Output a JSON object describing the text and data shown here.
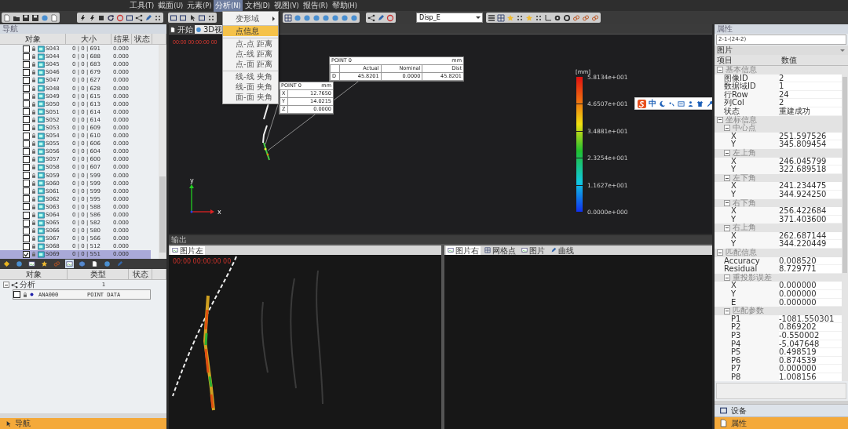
{
  "menu_bar": {
    "items": [
      {
        "label": "工具",
        "shortcut": "(T)",
        "open": false
      },
      {
        "label": "截面",
        "shortcut": "(U)",
        "open": false
      },
      {
        "label": "元素",
        "shortcut": "(P)",
        "open": false
      },
      {
        "label": "分析",
        "shortcut": "(N)",
        "open": true
      },
      {
        "label": "文档",
        "shortcut": "(D)",
        "open": false
      },
      {
        "label": "视图",
        "shortcut": "(V)",
        "open": false
      },
      {
        "label": "报告",
        "shortcut": "(R)",
        "open": false
      },
      {
        "label": "帮助",
        "shortcut": "(H)",
        "open": false
      }
    ]
  },
  "toolbar": {
    "display_combo": "Disp_E"
  },
  "analysis_menu": {
    "items": [
      {
        "label": "变形域",
        "has_submenu": true,
        "divider_above": false,
        "selected": false
      },
      {
        "label": "点信息",
        "has_submenu": false,
        "divider_above": true,
        "selected": true
      },
      {
        "label": "点-点 距离",
        "has_submenu": false,
        "divider_above": true,
        "selected": false
      },
      {
        "label": "点-线 距离",
        "has_submenu": false,
        "divider_above": false,
        "selected": false
      },
      {
        "label": "点-面 距离",
        "has_submenu": false,
        "divider_above": false,
        "selected": false
      },
      {
        "label": "线-线 夹角",
        "has_submenu": false,
        "divider_above": true,
        "selected": false
      },
      {
        "label": "线-面 夹角",
        "has_submenu": false,
        "divider_above": false,
        "selected": false
      },
      {
        "label": "面-面 夹角",
        "has_submenu": false,
        "divider_above": false,
        "selected": false
      }
    ]
  },
  "navigator": {
    "title": "导航",
    "columns": [
      "对象",
      "大小",
      "结果",
      "状态"
    ],
    "rows": [
      {
        "name": "S043",
        "size": "0 | 0 | 691",
        "result": "0.000",
        "checked": false,
        "selected": false
      },
      {
        "name": "S044",
        "size": "0 | 0 | 688",
        "result": "0.000",
        "checked": false,
        "selected": false
      },
      {
        "name": "S045",
        "size": "0 | 0 | 683",
        "result": "0.000",
        "checked": false,
        "selected": false
      },
      {
        "name": "S046",
        "size": "0 | 0 | 679",
        "result": "0.000",
        "checked": false,
        "selected": false
      },
      {
        "name": "S047",
        "size": "0 | 0 | 627",
        "result": "0.000",
        "checked": false,
        "selected": false
      },
      {
        "name": "S048",
        "size": "0 | 0 | 628",
        "result": "0.000",
        "checked": false,
        "selected": false
      },
      {
        "name": "S049",
        "size": "0 | 0 | 615",
        "result": "0.000",
        "checked": false,
        "selected": false
      },
      {
        "name": "S050",
        "size": "0 | 0 | 613",
        "result": "0.000",
        "checked": false,
        "selected": false
      },
      {
        "name": "S051",
        "size": "0 | 0 | 614",
        "result": "0.000",
        "checked": false,
        "selected": false
      },
      {
        "name": "S052",
        "size": "0 | 0 | 614",
        "result": "0.000",
        "checked": false,
        "selected": false
      },
      {
        "name": "S053",
        "size": "0 | 0 | 609",
        "result": "0.000",
        "checked": false,
        "selected": false
      },
      {
        "name": "S054",
        "size": "0 | 0 | 610",
        "result": "0.000",
        "checked": false,
        "selected": false
      },
      {
        "name": "S055",
        "size": "0 | 0 | 606",
        "result": "0.000",
        "checked": false,
        "selected": false
      },
      {
        "name": "S056",
        "size": "0 | 0 | 604",
        "result": "0.000",
        "checked": false,
        "selected": false
      },
      {
        "name": "S057",
        "size": "0 | 0 | 600",
        "result": "0.000",
        "checked": false,
        "selected": false
      },
      {
        "name": "S058",
        "size": "0 | 0 | 607",
        "result": "0.000",
        "checked": false,
        "selected": false
      },
      {
        "name": "S059",
        "size": "0 | 0 | 599",
        "result": "0.000",
        "checked": false,
        "selected": false
      },
      {
        "name": "S060",
        "size": "0 | 0 | 599",
        "result": "0.000",
        "checked": false,
        "selected": false
      },
      {
        "name": "S061",
        "size": "0 | 0 | 599",
        "result": "0.000",
        "checked": false,
        "selected": false
      },
      {
        "name": "S062",
        "size": "0 | 0 | 595",
        "result": "0.000",
        "checked": false,
        "selected": false
      },
      {
        "name": "S063",
        "size": "0 | 0 | 588",
        "result": "0.000",
        "checked": false,
        "selected": false
      },
      {
        "name": "S064",
        "size": "0 | 0 | 586",
        "result": "0.000",
        "checked": false,
        "selected": false
      },
      {
        "name": "S065",
        "size": "0 | 0 | 582",
        "result": "0.000",
        "checked": false,
        "selected": false
      },
      {
        "name": "S066",
        "size": "0 | 0 | 580",
        "result": "0.000",
        "checked": false,
        "selected": false
      },
      {
        "name": "S067",
        "size": "0 | 0 | 566",
        "result": "0.000",
        "checked": false,
        "selected": false
      },
      {
        "name": "S068",
        "size": "0 | 0 | 512",
        "result": "0.000",
        "checked": false,
        "selected": false
      },
      {
        "name": "S069",
        "size": "0 | 0 | 551",
        "result": "0.000",
        "checked": true,
        "selected": true
      }
    ],
    "icon_tabs": [
      {
        "selected": false
      },
      {
        "selected": false
      },
      {
        "selected": false
      },
      {
        "selected": false
      },
      {
        "selected": false
      },
      {
        "selected": true
      },
      {
        "selected": false
      },
      {
        "selected": false
      },
      {
        "selected": false
      },
      {
        "selected": false
      }
    ],
    "lower_columns": [
      "对象",
      "类型",
      "状态"
    ],
    "tree": [
      {
        "name": "分析",
        "type": "1",
        "expanded": true,
        "children": [
          {
            "name": "ANA000",
            "type": "POINT DATA",
            "checked": false
          }
        ]
      }
    ],
    "footer": "导航"
  },
  "view_tabs": [
    {
      "label": "开始",
      "selected": false
    },
    {
      "label": "3D视",
      "selected": true
    }
  ],
  "view_3d": {
    "timestamp": "00:00 00:00:00 00",
    "point_label": {
      "title": "POINT 0",
      "unit": "mm",
      "rows": [
        {
          "axis": "X",
          "value": "12.7650"
        },
        {
          "axis": "Y",
          "value": "14.0215"
        },
        {
          "axis": "Z",
          "value": "0.0000"
        }
      ]
    },
    "deviation_label": {
      "title": "POINT 0",
      "unit": "mm",
      "columns": [
        "Actual",
        "Nominal",
        "Dist"
      ],
      "row": {
        "axis": "D",
        "values": [
          "45.8201",
          "0.0000",
          "45.8201"
        ]
      }
    },
    "color_scale": {
      "unit": "[mm]",
      "ticks": [
        "5.8134e+001",
        "4.6507e+001",
        "3.4881e+001",
        "2.3254e+001",
        "1.1627e+001",
        "0.0000e+000"
      ]
    },
    "axes": {
      "vertical": "y",
      "horizontal": "x"
    }
  },
  "ime_toolbar": {
    "mode": "中"
  },
  "output": {
    "title": "输出",
    "left_tabs": [
      {
        "label": "图片左",
        "selected": true
      }
    ],
    "left_timestamp": "00:00 00:00:00 00",
    "right_tabs": [
      {
        "label": "图片右",
        "selected": true
      },
      {
        "label": "网格点",
        "selected": false
      },
      {
        "label": "图片",
        "selected": false
      },
      {
        "label": "曲线",
        "selected": false
      }
    ]
  },
  "properties": {
    "title": "属性",
    "path": "2-1-(24-2)",
    "category": "图片",
    "columns": [
      "项目",
      "数值"
    ],
    "groups": [
      {
        "label": "基本信息",
        "expanded": true,
        "children": [
          {
            "label": "图像ID",
            "value": "2"
          },
          {
            "label": "数据域ID",
            "value": "1"
          },
          {
            "label": "行Row",
            "value": "24"
          },
          {
            "label": "列Col",
            "value": "2"
          },
          {
            "label": "状态",
            "value": "重建成功"
          }
        ]
      },
      {
        "label": "坐标信息",
        "expanded": true,
        "children": [
          {
            "label": "中心点",
            "expanded": true,
            "children": [
              {
                "label": "X",
                "value": "251.597526"
              },
              {
                "label": "Y",
                "value": "345.809454"
              }
            ]
          },
          {
            "label": "左上角",
            "expanded": true,
            "children": [
              {
                "label": "X",
                "value": "246.045799"
              },
              {
                "label": "Y",
                "value": "322.689518"
              }
            ]
          },
          {
            "label": "左下角",
            "expanded": true,
            "children": [
              {
                "label": "X",
                "value": "241.234475"
              },
              {
                "label": "Y",
                "value": "344.924250"
              }
            ]
          },
          {
            "label": "右下角",
            "expanded": true,
            "children": [
              {
                "label": "X",
                "value": "256.422684"
              },
              {
                "label": "Y",
                "value": "371.403600"
              }
            ]
          },
          {
            "label": "右上角",
            "expanded": true,
            "children": [
              {
                "label": "X",
                "value": "262.687144"
              },
              {
                "label": "Y",
                "value": "344.220449"
              }
            ]
          }
        ]
      },
      {
        "label": "匹配信息",
        "expanded": true,
        "children": [
          {
            "label": "Accuracy",
            "value": "0.008520"
          },
          {
            "label": "Residual",
            "value": "8.729771"
          },
          {
            "label": "重投影误差",
            "expanded": true,
            "children": [
              {
                "label": "X",
                "value": "0.000000"
              },
              {
                "label": "Y",
                "value": "0.000000"
              },
              {
                "label": "E",
                "value": "0.000000"
              }
            ]
          },
          {
            "label": "匹配参数",
            "expanded": true,
            "children": [
              {
                "label": "P1",
                "value": "-1081.550301"
              },
              {
                "label": "P2",
                "value": "0.869202"
              },
              {
                "label": "P3",
                "value": "-0.550002"
              },
              {
                "label": "P4",
                "value": "-5.047648"
              },
              {
                "label": "P5",
                "value": "0.498519"
              },
              {
                "label": "P6",
                "value": "0.874539"
              },
              {
                "label": "P7",
                "value": "0.000000"
              },
              {
                "label": "P8",
                "value": "1.008156"
              }
            ]
          }
        ]
      }
    ]
  },
  "bottom_tabs": [
    {
      "label": "设备",
      "selected": false
    },
    {
      "label": "属性",
      "selected": true
    }
  ]
}
